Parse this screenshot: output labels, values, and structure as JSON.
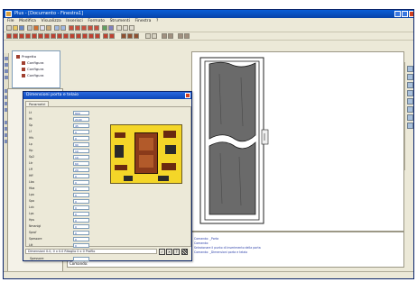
{
  "window": {
    "title": "Plus - [Documento - Finestra1]"
  },
  "menu": [
    "File",
    "Modifica",
    "Visualizza",
    "Inserisci",
    "Formato",
    "Strumenti",
    "Finestra",
    "?"
  ],
  "tree": {
    "items": [
      "Progetto",
      "Configura",
      "Configura",
      "Configura"
    ]
  },
  "dialog": {
    "title": "Dimensioni porta e telaio",
    "tab": "Parametri",
    "params": [
      {
        "label": "Lt",
        "value": "800"
      },
      {
        "label": "Ht",
        "value": "2100"
      },
      {
        "label": "Sp",
        "value": "45"
      },
      {
        "label": "Lf",
        "value": "0"
      },
      {
        "label": "Hfs",
        "value": "0"
      },
      {
        "label": "Lp",
        "value": "90"
      },
      {
        "label": "Hp",
        "value": "10"
      },
      {
        "label": "Sp2",
        "value": "10"
      },
      {
        "label": "Ltr",
        "value": "60"
      },
      {
        "label": "Lff",
        "value": "20"
      },
      {
        "label": "Hff",
        "value": "0"
      },
      {
        "label": "Lba",
        "value": "0"
      },
      {
        "label": "Hba",
        "value": "0"
      },
      {
        "label": "Lpa",
        "value": "0"
      },
      {
        "label": "Spa",
        "value": "0"
      },
      {
        "label": "Lcb",
        "value": "0"
      },
      {
        "label": "Lps",
        "value": "0"
      },
      {
        "label": "Hps",
        "value": "0"
      },
      {
        "label": "Nmanigl",
        "value": "0"
      },
      {
        "label": "Sprof",
        "value": "0"
      },
      {
        "label": "Spessore",
        "value": "0"
      },
      {
        "label": "Ltt",
        "value": "0"
      }
    ],
    "footer_label": "Spessore",
    "status_text": "Dimensioni 0.0, 0 x 0.0 Ritaglio 0 x 0 Profilo",
    "button_glyphs": [
      "✓",
      "✕",
      "?"
    ]
  },
  "side_panel": {
    "bottom_label": "Livelli"
  },
  "command_area": {
    "lines": [
      "Comando: _Porta",
      "Comando:",
      "Selezionare il punto di inserimento della porta",
      "Comando: _Dimensioni porta e telaio"
    ],
    "prompt": "Comando:"
  },
  "colors": {
    "title_bar": "#0a4fc8",
    "preview_bg": "#f4d628",
    "door_panel": "#6a6a6a"
  }
}
